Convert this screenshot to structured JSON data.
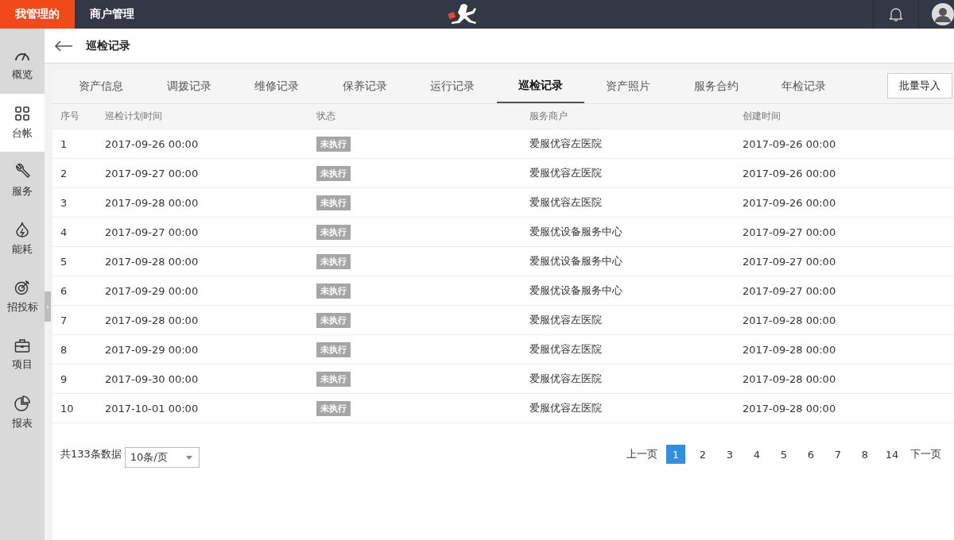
{
  "topbar": {
    "nav": [
      {
        "label": "我管理的",
        "selected": true
      },
      {
        "label": "商户管理",
        "selected": false
      }
    ]
  },
  "sidebar": {
    "items": [
      {
        "label": "概览",
        "selected": false
      },
      {
        "label": "台帐",
        "selected": true
      },
      {
        "label": "服务",
        "selected": false
      },
      {
        "label": "能耗",
        "selected": false
      },
      {
        "label": "招投标",
        "selected": false
      },
      {
        "label": "项目",
        "selected": false
      },
      {
        "label": "报表",
        "selected": false
      }
    ],
    "toggle": "›"
  },
  "page": {
    "title": "巡检记录"
  },
  "tabs": [
    {
      "label": "资产信息",
      "selected": false
    },
    {
      "label": "调拨记录",
      "selected": false
    },
    {
      "label": "维修记录",
      "selected": false
    },
    {
      "label": "保养记录",
      "selected": false
    },
    {
      "label": "运行记录",
      "selected": false
    },
    {
      "label": "巡检记录",
      "selected": true
    },
    {
      "label": "资产照片",
      "selected": false
    },
    {
      "label": "服务合约",
      "selected": false
    },
    {
      "label": "年检记录",
      "selected": false
    }
  ],
  "import_button": "批量导入",
  "table": {
    "columns": [
      "序号",
      "巡检计划时间",
      "状态",
      "服务商户",
      "创建时间"
    ],
    "rows": [
      [
        "1",
        "2017-09-26 00:00",
        "未执行",
        "爱服优容左医院",
        "2017-09-26 00:00"
      ],
      [
        "2",
        "2017-09-27 00:00",
        "未执行",
        "爱服优容左医院",
        "2017-09-26 00:00"
      ],
      [
        "3",
        "2017-09-28 00:00",
        "未执行",
        "爱服优容左医院",
        "2017-09-26 00:00"
      ],
      [
        "4",
        "2017-09-27 00:00",
        "未执行",
        "爱服优设备服务中心",
        "2017-09-27 00:00"
      ],
      [
        "5",
        "2017-09-28 00:00",
        "未执行",
        "爱服优设备服务中心",
        "2017-09-27 00:00"
      ],
      [
        "6",
        "2017-09-29 00:00",
        "未执行",
        "爱服优设备服务中心",
        "2017-09-27 00:00"
      ],
      [
        "7",
        "2017-09-28 00:00",
        "未执行",
        "爱服优容左医院",
        "2017-09-28 00:00"
      ],
      [
        "8",
        "2017-09-29 00:00",
        "未执行",
        "爱服优容左医院",
        "2017-09-28 00:00"
      ],
      [
        "9",
        "2017-09-30 00:00",
        "未执行",
        "爱服优容左医院",
        "2017-09-28 00:00"
      ],
      [
        "10",
        "2017-10-01 00:00",
        "未执行",
        "爱服优容左医院",
        "2017-09-28 00:00"
      ]
    ]
  },
  "pagination": {
    "total": "共133条数据",
    "page_size": "10条/页",
    "prev": "上一页",
    "next": "下一页",
    "pages": [
      {
        "label": "1",
        "selected": true
      },
      {
        "label": "2",
        "selected": false
      },
      {
        "label": "3",
        "selected": false
      },
      {
        "label": "4",
        "selected": false
      },
      {
        "label": "5",
        "selected": false
      },
      {
        "label": "6",
        "selected": false
      },
      {
        "label": "7",
        "selected": false
      },
      {
        "label": "8",
        "selected": false
      },
      {
        "label": "14",
        "selected": false
      }
    ]
  }
}
